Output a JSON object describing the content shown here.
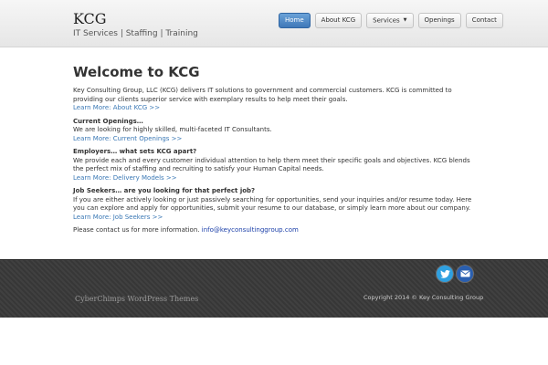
{
  "header": {
    "site_title": "KCG",
    "tagline": "IT Services | Staffing | Training"
  },
  "nav": {
    "items": [
      {
        "label": "Home"
      },
      {
        "label": "About KCG"
      },
      {
        "label": "Services"
      },
      {
        "label": "Openings"
      },
      {
        "label": "Contact"
      }
    ]
  },
  "main": {
    "title": "Welcome to KCG",
    "sections": [
      {
        "heading": "",
        "text": "Key Consulting Group, LLC (KCG) delivers IT solutions to government and commercial customers.  KCG is committed to providing our clients superior service with exemplary results to help meet their goals.",
        "link": "Learn More: About KCG >>"
      },
      {
        "heading": "Current Openings…",
        "text": "We are looking for highly skilled, multi-faceted IT Consultants.",
        "link": "Learn More: Current Openings >>"
      },
      {
        "heading": "Employers… what sets KCG apart?",
        "text": "We provide each and every customer individual attention to help them meet their specific goals and objectives.  KCG blends the perfect mix of staffing and recruiting to satisfy your Human Capital needs.",
        "link": "Learn More: Delivery Models >>"
      },
      {
        "heading": "Job Seekers… are you looking for that perfect job?",
        "text": "If you are either actively looking or just passively searching for opportunities, send your inquiries and/or resume today. Here you can explore and apply for opportunities, submit your resume to our database, or simply learn more about our company.",
        "link": "Learn More: Job Seekers >>"
      }
    ],
    "contact_text": "Please contact us for more information.",
    "contact_email": "info@keyconsultinggroup.com"
  },
  "footer": {
    "copyright": "Copyright 2014 © Key Consulting Group",
    "credit": "CyberChimps WordPress Themes",
    "social": [
      {
        "icon": "twitter-icon",
        "color": "#2fa0e0"
      },
      {
        "icon": "email-icon",
        "color": "#2a5fb0"
      }
    ]
  },
  "colors": {
    "nav_active": "#3f78b8",
    "link": "#3a78b5",
    "footer_bg": "#3a3a3a"
  }
}
